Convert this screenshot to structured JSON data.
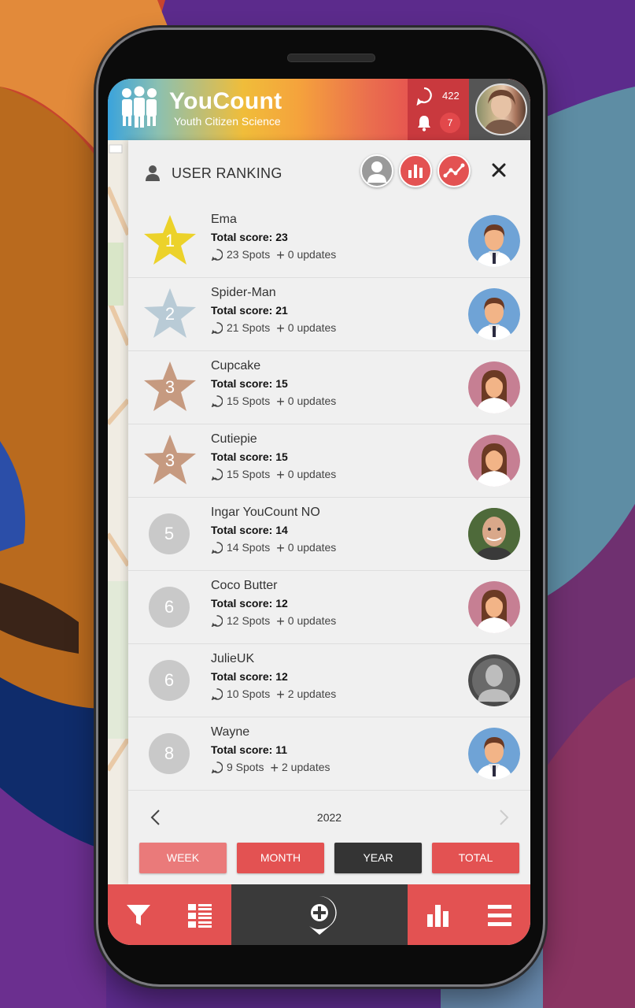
{
  "app": {
    "name": "YouCount",
    "subtitle": "Youth Citizen Science",
    "spot_count": "422",
    "notification_count": "7"
  },
  "panel": {
    "title": "USER RANKING",
    "view_buttons": [
      "profile-view",
      "bar-chart-view",
      "trend-view"
    ]
  },
  "ranking": [
    {
      "rank": "1",
      "badge": "gold-star",
      "name": "Ema",
      "score": "Total score: 23",
      "spots": "23 Spots",
      "updates": "0 updates",
      "avatar": "male"
    },
    {
      "rank": "2",
      "badge": "silver-star",
      "name": "Spider-Man",
      "score": "Total score: 21",
      "spots": "21 Spots",
      "updates": "0 updates",
      "avatar": "male"
    },
    {
      "rank": "3",
      "badge": "bronze-star",
      "name": "Cupcake",
      "score": "Total score: 15",
      "spots": "15 Spots",
      "updates": "0 updates",
      "avatar": "female"
    },
    {
      "rank": "3",
      "badge": "bronze-star",
      "name": "Cutiepie",
      "score": "Total score: 15",
      "spots": "15 Spots",
      "updates": "0 updates",
      "avatar": "female"
    },
    {
      "rank": "5",
      "badge": "circle",
      "name": "Ingar YouCount NO",
      "score": "Total score: 14",
      "spots": "14 Spots",
      "updates": "0 updates",
      "avatar": "photo"
    },
    {
      "rank": "6",
      "badge": "circle",
      "name": "Coco Butter",
      "score": "Total score: 12",
      "spots": "12 Spots",
      "updates": "0 updates",
      "avatar": "female"
    },
    {
      "rank": "6",
      "badge": "circle",
      "name": "JulieUK",
      "score": "Total score: 12",
      "spots": "10 Spots",
      "updates": "2 updates",
      "avatar": "placeholder"
    },
    {
      "rank": "8",
      "badge": "circle",
      "name": "Wayne",
      "score": "Total score: 11",
      "spots": "9 Spots",
      "updates": "2 updates",
      "avatar": "male"
    }
  ],
  "year_nav": {
    "year": "2022"
  },
  "period_tabs": [
    {
      "label": "WEEK",
      "state": "light"
    },
    {
      "label": "MONTH",
      "state": "normal"
    },
    {
      "label": "YEAR",
      "state": "active"
    },
    {
      "label": "TOTAL",
      "state": "normal"
    }
  ],
  "colors": {
    "accent_red": "#e35252",
    "dark": "#3a3a3a",
    "gold": "#ecd22a",
    "silver": "#b9cbd6",
    "bronze": "#c69a80",
    "grey_badge": "#c9c9c9"
  },
  "bottom_bar": {
    "icons": [
      "filter-icon",
      "list-icon",
      "add-spot-icon",
      "ranking-icon",
      "menu-icon"
    ]
  }
}
